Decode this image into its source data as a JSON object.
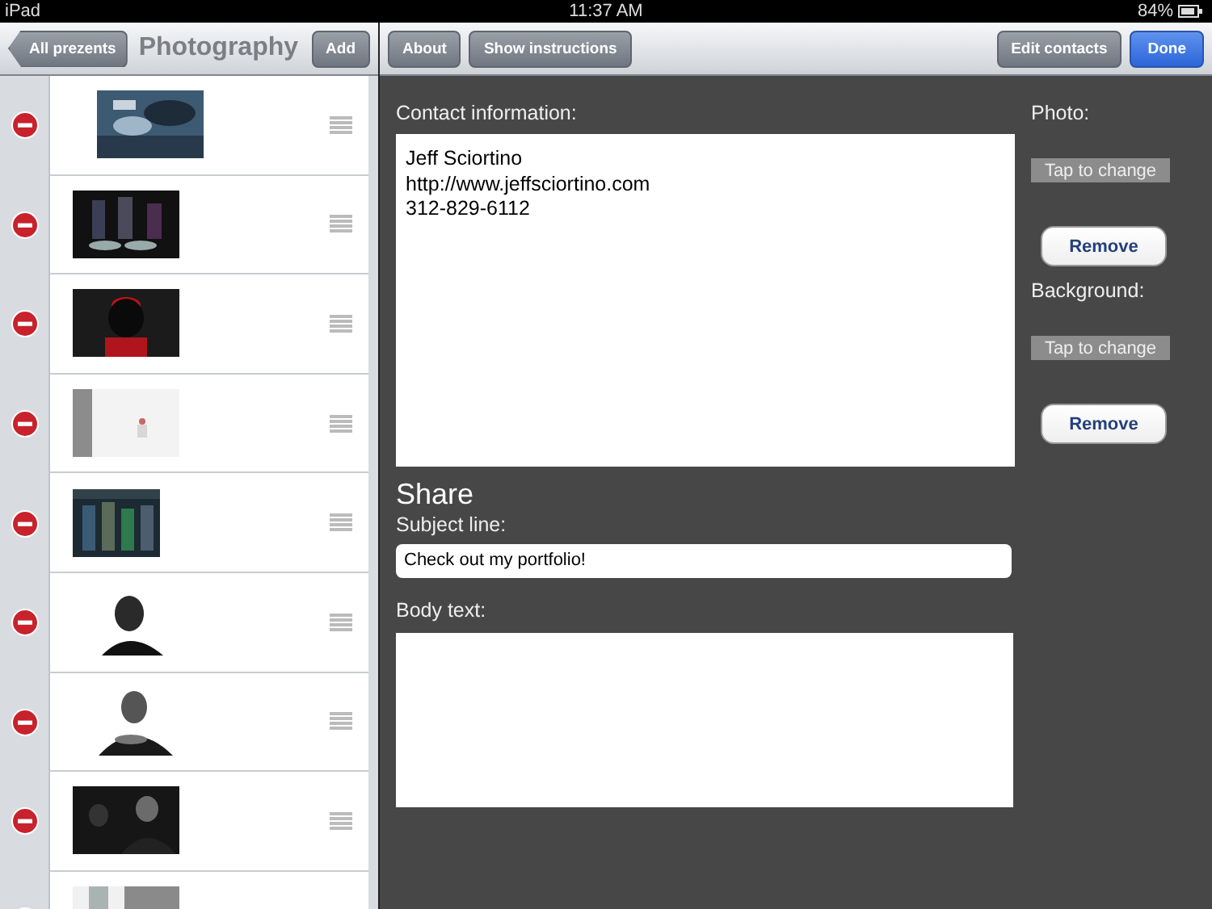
{
  "status_bar": {
    "device": "iPad",
    "time": "11:37 AM",
    "battery": "84%"
  },
  "left_nav": {
    "back": "All prezents",
    "title": "Photography",
    "add": "Add"
  },
  "right_nav": {
    "buttons": [
      {
        "label": "About",
        "kind": "plain"
      },
      {
        "label": "Show instructions",
        "kind": "plain"
      }
    ],
    "right_buttons": [
      {
        "label": "Edit contacts",
        "kind": "plain"
      },
      {
        "label": "Done",
        "kind": "primary"
      }
    ]
  },
  "contact": {
    "label": "Contact information:",
    "value": "Jeff Sciortino\nhttp://www.jeffsciortino.com\n312-829-6112"
  },
  "share": {
    "heading": "Share",
    "subject_label": "Subject line:",
    "subject_value": "Check out my portfolio!",
    "body_label": "Body text:"
  },
  "images": [
    {
      "label": "Photo:",
      "change": "Tap to change",
      "remove": "Remove"
    },
    {
      "label": "Background:",
      "change": "Tap to change",
      "remove": "Remove"
    }
  ]
}
